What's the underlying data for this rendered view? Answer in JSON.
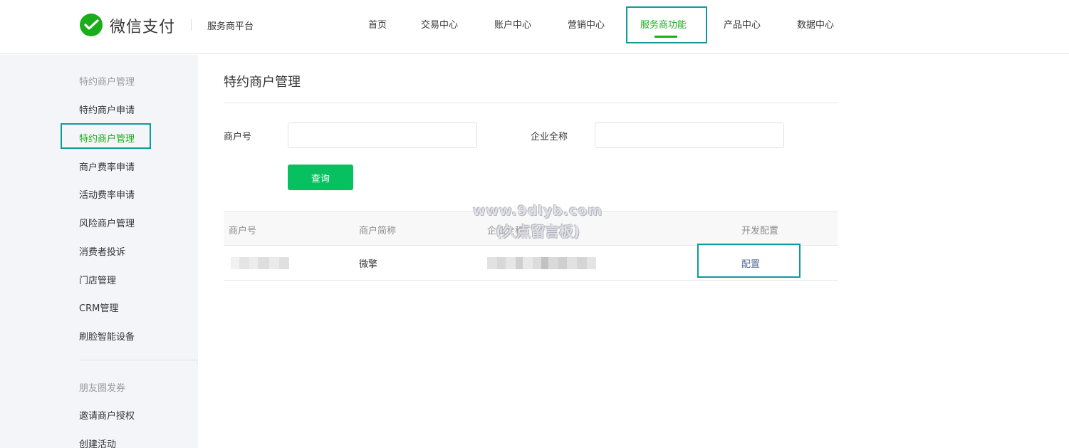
{
  "header": {
    "brand": "微信支付",
    "platform": "服务商平台",
    "nav": [
      {
        "label": "首页"
      },
      {
        "label": "交易中心"
      },
      {
        "label": "账户中心"
      },
      {
        "label": "营销中心"
      },
      {
        "label": "服务商功能",
        "active": true
      },
      {
        "label": "产品中心"
      },
      {
        "label": "数据中心"
      }
    ]
  },
  "sidebar": {
    "groups": [
      {
        "title": "特约商户管理",
        "items": [
          "特约商户申请",
          "特约商户管理",
          "商户费率申请",
          "活动费率申请",
          "风险商户管理",
          "消费者投诉",
          "门店管理",
          "CRM管理",
          "刷脸智能设备"
        ]
      },
      {
        "title": "朋友圈发券",
        "items": [
          "邀请商户授权",
          "创建活动"
        ]
      }
    ],
    "active_item": "特约商户管理"
  },
  "main": {
    "title": "特约商户管理",
    "form": {
      "merchant_no_label": "商户号",
      "merchant_no_value": "",
      "company_name_label": "企业全称",
      "company_name_value": "",
      "query_button": "查询"
    },
    "table": {
      "columns": [
        "商户号",
        "商户简称",
        "企业全称",
        "开发配置"
      ],
      "rows": [
        {
          "merchant_short_name": "微擎",
          "action": "配置"
        }
      ]
    }
  },
  "watermark": {
    "line1": "www.9dlyb.com",
    "line2": "(久点留言板)"
  },
  "colors": {
    "accent": "#1aad19",
    "button": "#07c160",
    "highlight_box": "#119a9a",
    "link": "#576b95"
  }
}
